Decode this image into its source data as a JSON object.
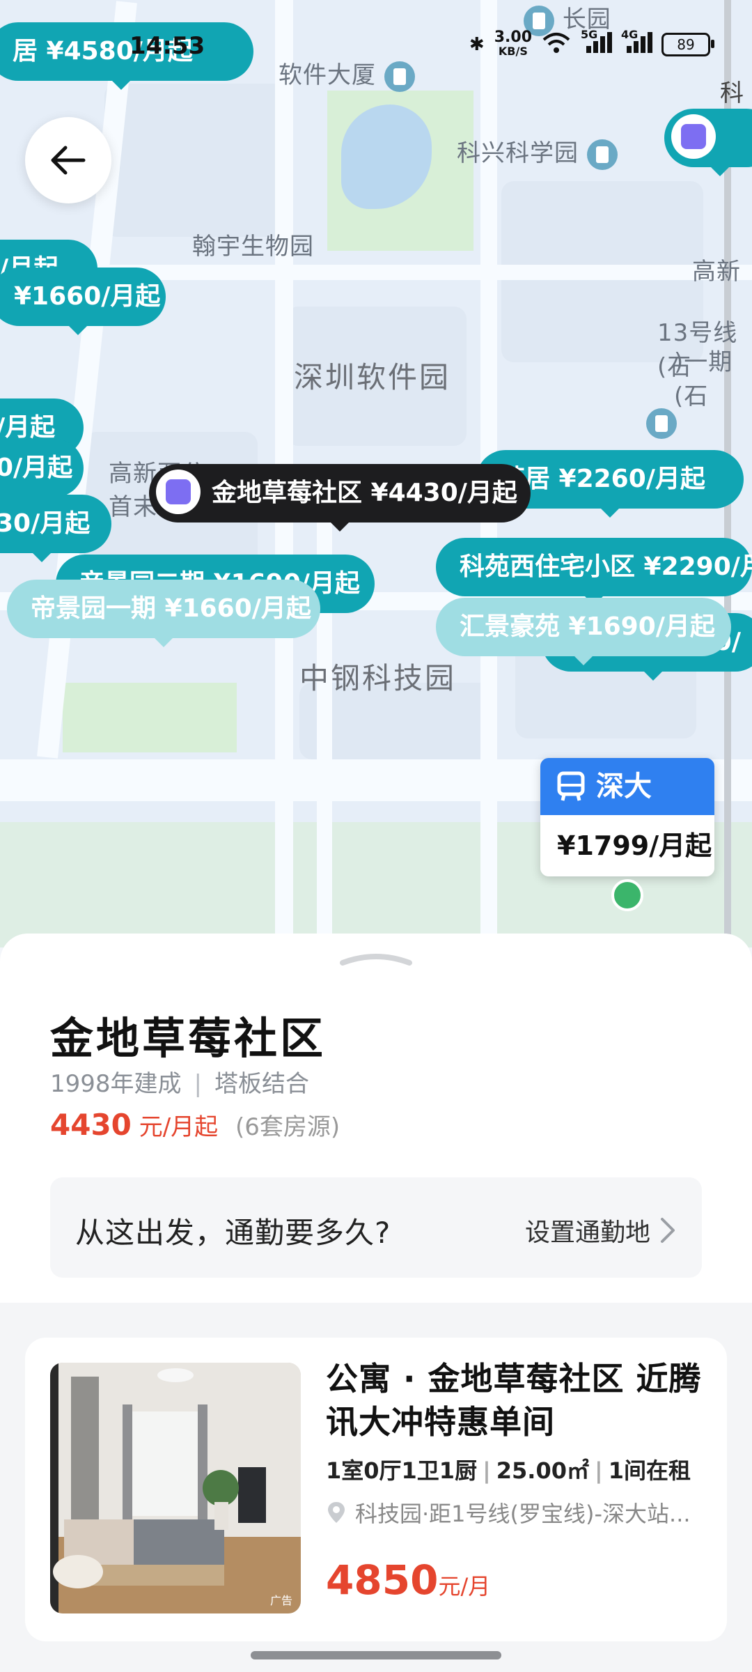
{
  "status_bar": {
    "time": "14:53",
    "net_speed": "3.00",
    "net_unit": "KB/S",
    "sim1": "5G",
    "sim2": "4G",
    "battery": "89"
  },
  "map": {
    "labels": {
      "changyuan": "长园",
      "software_building": "软件大厦",
      "kexing_park": "科兴科学园",
      "hanyu_bio": "翰宇生物园",
      "gaoxin_right": "高新",
      "line13": "13号线(石",
      "line13_b": ")一期(石",
      "shenzhen_software_park": "深圳软件园",
      "gaoxin_xi_a": "高新西公",
      "gaoxin_xi_b": "首末",
      "zhonggang": "中钢科技园",
      "ke_edge": "科"
    },
    "pins": [
      {
        "text": "居 ¥4580/月起"
      },
      {
        "text": "0/月起"
      },
      {
        "text": "¥1660/月起"
      },
      {
        "text": "/月起"
      },
      {
        "text": "/月起"
      },
      {
        "text": "0/月起"
      },
      {
        "text": "30/月起"
      },
      {
        "text": "苑居 ¥2260/月起"
      },
      {
        "text": "科苑西住宅小区 ¥2290/月"
      },
      {
        "text": "帝景园二期 ¥1690/月起"
      },
      {
        "text": "帝景园一期 ¥1660/月起"
      },
      {
        "text": "汇景豪苑 ¥1690/月起"
      },
      {
        "text": "90/"
      }
    ],
    "selected_pin": "金地草莓社区 ¥4430/月起",
    "station": {
      "name": "深大",
      "price": "¥1799/月起"
    }
  },
  "sheet": {
    "title": "金地草莓社区",
    "built": "1998年建成",
    "divider": "|",
    "structure": "塔板结合",
    "price_num": "4430",
    "price_unit": "元/月起",
    "listing_count": "(6套房源)",
    "commute_question": "从这出发，通勤要多久?",
    "commute_action": "设置通勤地",
    "listing": {
      "title": "公寓 · 金地草莓社区 近腾讯大冲特惠单间",
      "layout": "1室0厅1卫1厨",
      "area": "25.00㎡",
      "availability": "1间在租",
      "sep": "|",
      "location": "科技园·距1号线(罗宝线)-深大站...",
      "price_num": "4850",
      "price_unit": "元/月",
      "ad_tag": "广告"
    }
  }
}
